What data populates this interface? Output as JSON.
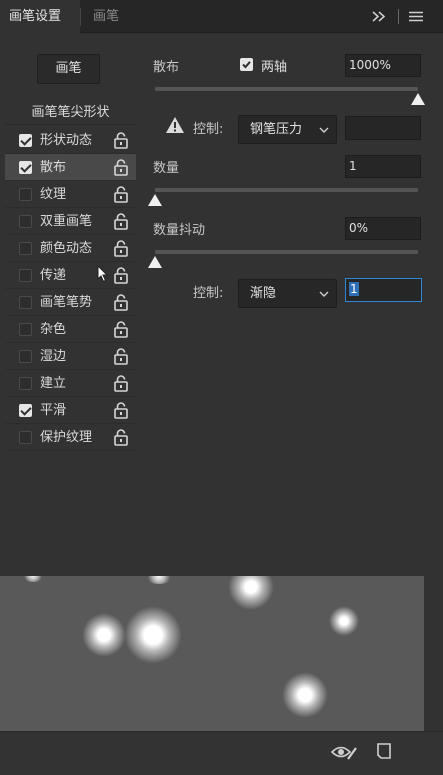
{
  "tabs": [
    {
      "label": "画笔设置",
      "active": true
    },
    {
      "label": "画笔",
      "active": false
    }
  ],
  "toolbar": {
    "expand_icon": "double-chevron-right-icon",
    "menu_icon": "hamburger-menu-icon"
  },
  "left": {
    "brush_button": "画笔",
    "tip_shape": "画笔笔尖形状",
    "options": [
      {
        "label": "形状动态",
        "checked": true,
        "selected": false
      },
      {
        "label": "散布",
        "checked": true,
        "selected": true
      },
      {
        "label": "纹理",
        "checked": false,
        "selected": false
      },
      {
        "label": "双重画笔",
        "checked": false,
        "selected": false
      },
      {
        "label": "颜色动态",
        "checked": false,
        "selected": false
      },
      {
        "label": "传递",
        "checked": false,
        "selected": false
      },
      {
        "label": "画笔笔势",
        "checked": false,
        "selected": false
      },
      {
        "label": "杂色",
        "checked": false,
        "selected": false
      },
      {
        "label": "湿边",
        "checked": false,
        "selected": false
      },
      {
        "label": "建立",
        "checked": false,
        "selected": false
      },
      {
        "label": "平滑",
        "checked": true,
        "selected": false
      },
      {
        "label": "保护纹理",
        "checked": false,
        "selected": false
      }
    ]
  },
  "scatter": {
    "label": "散布",
    "both_axes_label": "两轴",
    "both_axes_checked": true,
    "value": "1000%",
    "slider_level": 1.0,
    "control_label": "控制:",
    "control_value": "钢笔压力",
    "control_field": ""
  },
  "count": {
    "label": "数量",
    "value": "1",
    "slider_level": 0.0
  },
  "count_jitter": {
    "label": "数量抖动",
    "value": "0%",
    "slider_level": 0.0,
    "control_label": "控制:",
    "control_value": "渐隐",
    "control_field": "1"
  },
  "colors": {
    "accent_focus": "#2f86d6",
    "panel": "#323232"
  }
}
